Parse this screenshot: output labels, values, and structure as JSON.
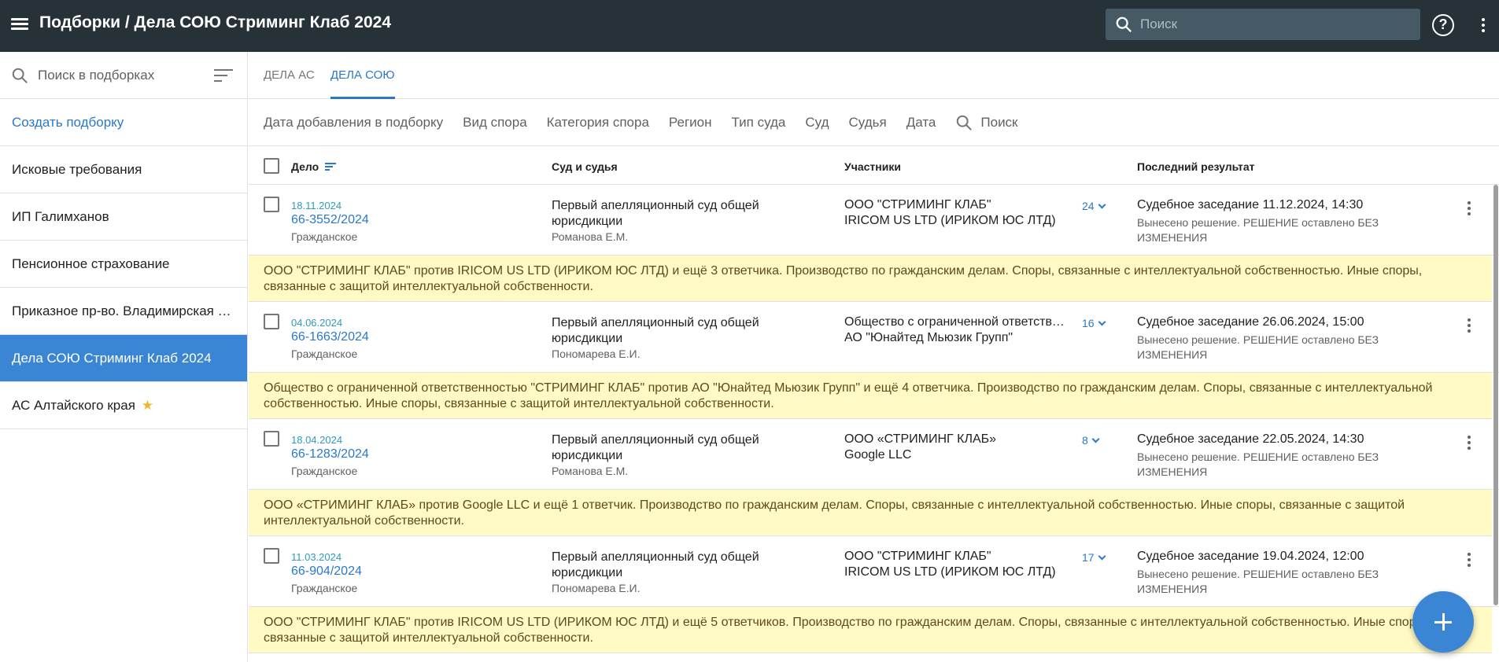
{
  "header": {
    "title": "Подборки / Дела СОЮ Стриминг Клаб 2024",
    "search_placeholder": "Поиск",
    "help_label": "?"
  },
  "sidebar": {
    "search_placeholder": "Поиск в подборках",
    "create_label": "Создать подборку",
    "items": [
      {
        "label": "Исковые требования"
      },
      {
        "label": "ИП Галимханов"
      },
      {
        "label": "Пенсионное страхование"
      },
      {
        "label": "Приказное пр-во. Владимирская о..."
      },
      {
        "label": "Дела СОЮ Стриминг Клаб 2024",
        "active": true
      },
      {
        "label": "АС Алтайского края",
        "starred": true
      }
    ]
  },
  "tabs": [
    {
      "label": "ДЕЛА АС"
    },
    {
      "label": "ДЕЛА СОЮ",
      "active": true
    }
  ],
  "filters": [
    "Дата добавления в подборку",
    "Вид спора",
    "Категория спора",
    "Регион",
    "Тип суда",
    "Суд",
    "Судья",
    "Дата"
  ],
  "filter_search_label": "Поиск",
  "table": {
    "columns": [
      "Дело",
      "Суд и судья",
      "Участники",
      "Последний результат"
    ],
    "rows": [
      {
        "date": "18.11.2024",
        "case": "66-3552/2024",
        "type": "Гражданское",
        "court": "Первый апелляционный суд общей юрисдикции",
        "judge": "Романова Е.М.",
        "party1": "ООО \"СТРИМИНГ КЛАБ\"",
        "party2": "IRICOM US LTD (ИРИКОМ ЮС ЛТД)",
        "count": "24",
        "result": "Судебное заседание 11.12.2024, 14:30",
        "result_detail": "Вынесено решение. РЕШЕНИЕ оставлено БЕЗ ИЗМЕНЕНИЯ",
        "summary": "ООО \"СТРИМИНГ КЛАБ\" против IRICOM US LTD (ИРИКОМ ЮС ЛТД) и ещё 3 ответчика. Производство по гражданским делам. Споры, связанные с интеллектуальной собственностью. Иные споры, связанные с защитой интеллектуальной собственности."
      },
      {
        "date": "04.06.2024",
        "case": "66-1663/2024",
        "type": "Гражданское",
        "court": "Первый апелляционный суд общей юрисдикции",
        "judge": "Пономарева Е.И.",
        "party1": "Общество с ограниченной ответственностью \"СТРИМИНГ КЛАБ\"",
        "party2": "АО \"Юнайтед Мьюзик Групп\"",
        "count": "16",
        "result": "Судебное заседание 26.06.2024, 15:00",
        "result_detail": "Вынесено решение. РЕШЕНИЕ оставлено БЕЗ ИЗМЕНЕНИЯ",
        "summary": "Общество с ограниченной ответственностью \"СТРИМИНГ КЛАБ\" против АО \"Юнайтед Мьюзик Групп\" и ещё 4 ответчика. Производство по гражданским делам. Споры, связанные с интеллектуальной собственностью. Иные споры, связанные с защитой интеллектуальной собственности."
      },
      {
        "date": "18.04.2024",
        "case": "66-1283/2024",
        "type": "Гражданское",
        "court": "Первый апелляционный суд общей юрисдикции",
        "judge": "Романова Е.М.",
        "party1": "ООО «СТРИМИНГ КЛАБ»",
        "party2": "Google LLC",
        "count": "8",
        "result": "Судебное заседание 22.05.2024, 14:30",
        "result_detail": "Вынесено решение. РЕШЕНИЕ оставлено БЕЗ ИЗМЕНЕНИЯ",
        "summary": "ООО «СТРИМИНГ КЛАБ» против Google LLC и ещё 1 ответчик. Производство по гражданским делам. Споры, связанные с интеллектуальной собственностью. Иные споры, связанные с защитой интеллектуальной собственности."
      },
      {
        "date": "11.03.2024",
        "case": "66-904/2024",
        "type": "Гражданское",
        "court": "Первый апелляционный суд общей юрисдикции",
        "judge": "Пономарева Е.И.",
        "party1": "ООО \"СТРИМИНГ КЛАБ\"",
        "party2": "IRICOM US LTD (ИРИКОМ ЮС ЛТД)",
        "count": "17",
        "result": "Судебное заседание 19.04.2024, 12:00",
        "result_detail": "Вынесено решение. РЕШЕНИЕ оставлено БЕЗ ИЗМЕНЕНИЯ",
        "summary": "ООО \"СТРИМИНГ КЛАБ\" против IRICOM US LTD (ИРИКОМ ЮС ЛТД) и ещё 5 ответчиков. Производство по гражданским делам. Споры, связанные с интеллектуальной собственностью. Иные споры, связанные с защитой интеллектуальной собственности."
      }
    ]
  },
  "icons": {
    "menu": "menu-icon",
    "search": "search-icon",
    "help": "help-icon",
    "more": "more-vert-icon",
    "sort": "sort-icon",
    "star": "star-icon",
    "add": "add-icon"
  },
  "colors": {
    "topbar": "#263238",
    "accent": "#3a86d4",
    "link": "#2979c9",
    "summary_bg": "#fff9c4",
    "star": "#f2b52c"
  }
}
